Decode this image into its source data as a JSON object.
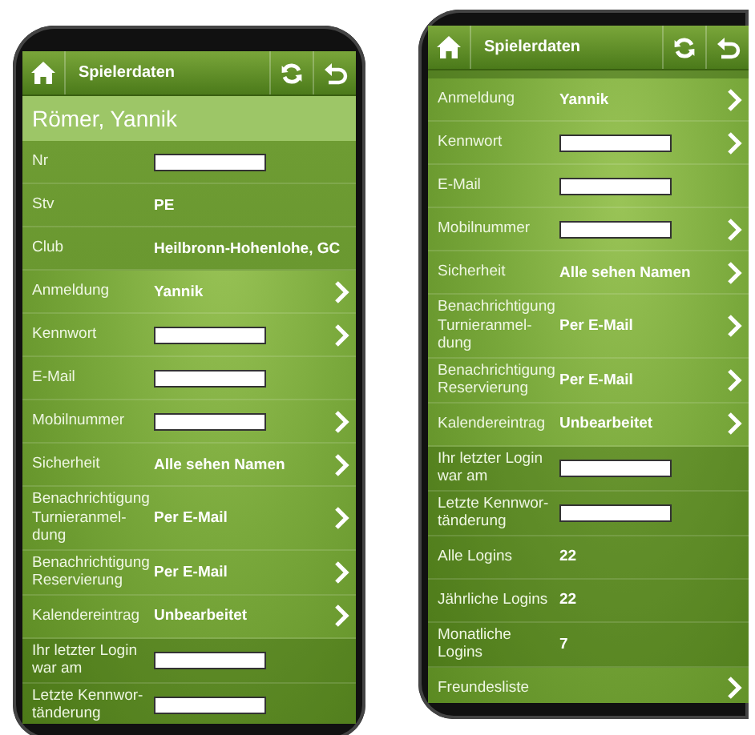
{
  "phones": [
    {
      "header": {
        "title": "Spielerdaten"
      },
      "name": "Römer, Yannik",
      "sections": [
        {
          "kind": "info",
          "rows": [
            {
              "label": "Nr",
              "kind": "redacted",
              "link": false
            },
            {
              "label": "Stv",
              "value": "PE",
              "link": false
            },
            {
              "label": "Club",
              "value": "Heilbronn-Hohenlohe, GC",
              "link": false
            }
          ]
        },
        {
          "kind": "links",
          "rows": [
            {
              "label": "Anmeldung",
              "value": "Yannik",
              "link": true
            },
            {
              "label": "Kennwort",
              "kind": "redacted",
              "link": true
            },
            {
              "label": "E-Mail",
              "kind": "redacted",
              "link": false
            },
            {
              "label": "Mobilnummer",
              "kind": "redacted",
              "link": true
            },
            {
              "label": "Sicherheit",
              "value": "Alle sehen Namen",
              "link": true
            },
            {
              "label": "Benachrichtigung Turnieranmel-dung",
              "value": "Per E-Mail",
              "link": true
            },
            {
              "label": "Benachrichtigung Reservierung",
              "value": "Per E-Mail",
              "link": true
            },
            {
              "label": "Kalendereintrag",
              "value": "Unbearbeitet",
              "link": true
            }
          ]
        },
        {
          "kind": "stats",
          "rows": [
            {
              "label": "Ihr letzter Login war am",
              "kind": "redacted",
              "link": false
            },
            {
              "label": "Letzte Kennwor-tänderung",
              "kind": "redacted",
              "link": false
            }
          ]
        }
      ]
    },
    {
      "header": {
        "title": "Spielerdaten"
      },
      "sections": [
        {
          "kind": "links",
          "rows": [
            {
              "label": "Anmeldung",
              "value": "Yannik",
              "link": true
            },
            {
              "label": "Kennwort",
              "kind": "redacted",
              "link": true
            },
            {
              "label": "E-Mail",
              "kind": "redacted",
              "link": false
            },
            {
              "label": "Mobilnummer",
              "kind": "redacted",
              "link": true
            },
            {
              "label": "Sicherheit",
              "value": "Alle sehen Namen",
              "link": true
            },
            {
              "label": "Benachrichtigung Turnieranmel-dung",
              "value": "Per E-Mail",
              "link": true
            },
            {
              "label": "Benachrichtigung Reservierung",
              "value": "Per E-Mail",
              "link": true
            },
            {
              "label": "Kalendereintrag",
              "value": "Unbearbeitet",
              "link": true
            }
          ]
        },
        {
          "kind": "stats",
          "rows": [
            {
              "label": "Ihr letzter Login war am",
              "kind": "redacted",
              "link": false
            },
            {
              "label": "Letzte Kennwor-tänderung",
              "kind": "redacted",
              "link": false
            },
            {
              "label": "Alle Logins",
              "value": "22",
              "link": false
            },
            {
              "label": "Jährliche Logins",
              "value": "22",
              "link": false
            },
            {
              "label": "Monatliche Logins",
              "value": "7",
              "link": false
            }
          ]
        },
        {
          "kind": "links",
          "rows": [
            {
              "label": "Freundesliste",
              "link": true
            }
          ]
        }
      ]
    }
  ]
}
